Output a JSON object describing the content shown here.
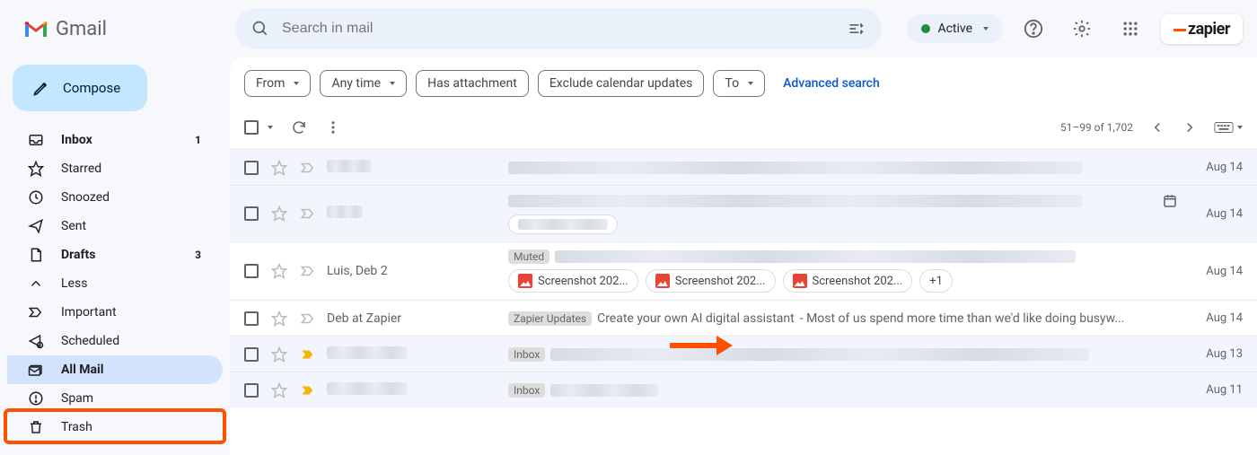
{
  "header": {
    "app_name": "Gmail",
    "search_placeholder": "Search in mail",
    "status_label": "Active",
    "brand_label": "zapier"
  },
  "sidebar": {
    "compose_label": "Compose",
    "items": [
      {
        "label": "Inbox",
        "count": "1"
      },
      {
        "label": "Starred"
      },
      {
        "label": "Snoozed"
      },
      {
        "label": "Sent"
      },
      {
        "label": "Drafts",
        "count": "3"
      },
      {
        "label": "Less"
      },
      {
        "label": "Important"
      },
      {
        "label": "Scheduled"
      },
      {
        "label": "All Mail"
      },
      {
        "label": "Spam"
      },
      {
        "label": "Trash"
      }
    ]
  },
  "filters": {
    "from": "From",
    "any_time": "Any time",
    "has_attachment": "Has attachment",
    "exclude_calendar": "Exclude calendar updates",
    "to": "To",
    "advanced": "Advanced search"
  },
  "toolbar": {
    "pagination": "51–99 of 1,702"
  },
  "rows": [
    {
      "date": "Aug 14"
    },
    {
      "date": "Aug 14"
    },
    {
      "sender": "Luis, Deb",
      "thread_count": "2",
      "muted_label": "Muted",
      "attachments": [
        "Screenshot 202...",
        "Screenshot 202...",
        "Screenshot 202..."
      ],
      "overflow": "+1",
      "date": "Aug 14"
    },
    {
      "sender": "Deb at Zapier",
      "tag": "Zapier Updates",
      "subject": "Create your own AI digital assistant",
      "snippet": " - Most of us spend more time than we'd like doing busyw...",
      "date": "Aug 14"
    },
    {
      "tag": "Inbox",
      "date": "Aug 13"
    },
    {
      "tag": "Inbox",
      "date": "Aug 11"
    }
  ]
}
